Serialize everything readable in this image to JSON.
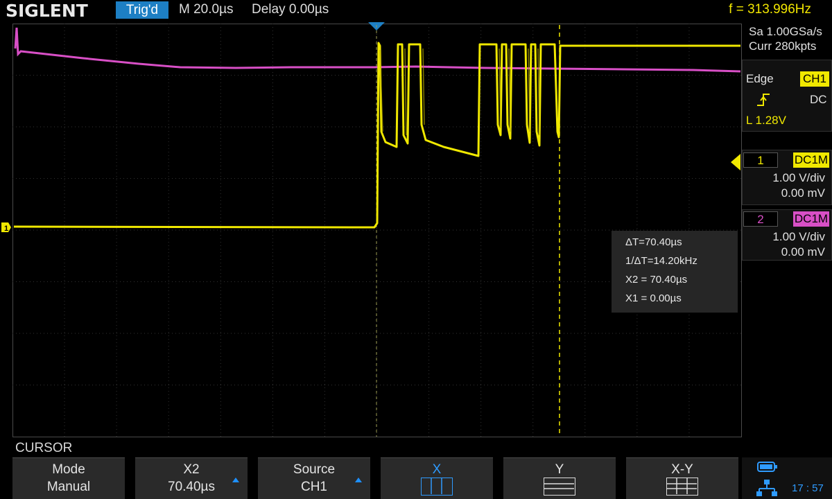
{
  "header": {
    "brand": "SIGLENT",
    "trigger_status": "Trig'd",
    "timebase": "M 20.0µs",
    "delay": "Delay 0.00µs",
    "frequency": "f = 313.996Hz"
  },
  "acquisition": {
    "sample_rate": "Sa 1.00GSa/s",
    "memory_depth": "Curr 280kpts"
  },
  "trigger": {
    "type": "Edge",
    "source": "CH1",
    "coupling": "DC",
    "level": "L  1.28V"
  },
  "channels": [
    {
      "number": "1",
      "coupling": "DC1M",
      "scale": "1.00 V/div",
      "offset": "0.00 mV",
      "color": "#f0e800"
    },
    {
      "number": "2",
      "coupling": "DC1M",
      "scale": "1.00 V/div",
      "offset": "0.00 mV",
      "color": "#d84fc6"
    }
  ],
  "cursor": {
    "delta_t": "ΔT=70.40µs",
    "inv_delta_t": "1/ΔT=14.20kHz",
    "x2": "X2 = 70.40µs",
    "x1": "X1 = 0.00µs"
  },
  "menu": {
    "title": "CURSOR",
    "softkeys": [
      {
        "line1": "Mode",
        "line2": "Manual"
      },
      {
        "line1": "X2",
        "line2": "70.40µs"
      },
      {
        "line1": "Source",
        "line2": "CH1"
      },
      {
        "line1": "X"
      },
      {
        "line1": "Y"
      },
      {
        "line1": "X-Y"
      }
    ]
  },
  "status": {
    "time": "17 : 57"
  },
  "colors": {
    "ch1": "#f0e800",
    "ch2": "#d84fc6",
    "accent": "#1d7fc4",
    "grid": "#3a3a3a"
  }
}
